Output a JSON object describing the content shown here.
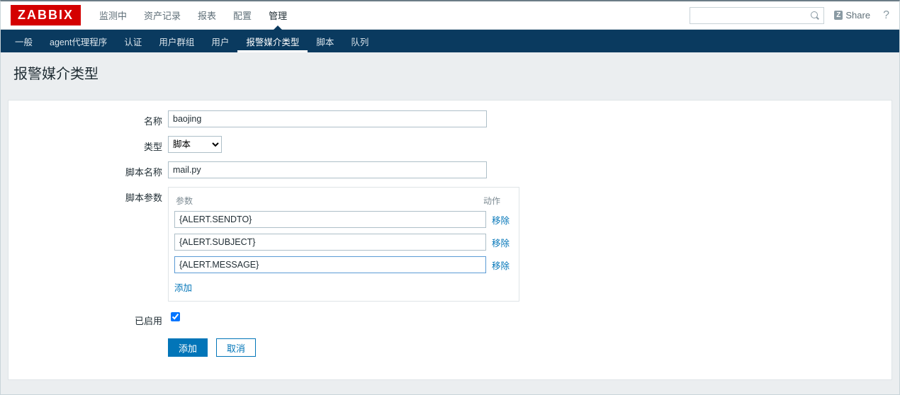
{
  "logo": "ZABBIX",
  "topnav": {
    "items": [
      {
        "label": "监测中"
      },
      {
        "label": "资产记录"
      },
      {
        "label": "报表"
      },
      {
        "label": "配置"
      },
      {
        "label": "管理",
        "active": true
      }
    ],
    "share": "Share",
    "help": "?"
  },
  "subnav": {
    "items": [
      {
        "label": "一般"
      },
      {
        "label": "agent代理程序"
      },
      {
        "label": "认证"
      },
      {
        "label": "用户群组"
      },
      {
        "label": "用户"
      },
      {
        "label": "报警媒介类型",
        "active": true
      },
      {
        "label": "脚本"
      },
      {
        "label": "队列"
      }
    ]
  },
  "page_title": "报警媒介类型",
  "form": {
    "name_label": "名称",
    "name_value": "baojing",
    "type_label": "类型",
    "type_value": "脚本",
    "script_name_label": "脚本名称",
    "script_name_value": "mail.py",
    "params_label": "脚本参数",
    "params_header_param": "参数",
    "params_header_action": "动作",
    "params": [
      {
        "value": "{ALERT.SENDTO}",
        "focused": false
      },
      {
        "value": "{ALERT.SUBJECT}",
        "focused": false
      },
      {
        "value": "{ALERT.MESSAGE}",
        "focused": true
      }
    ],
    "remove_label": "移除",
    "add_param_label": "添加",
    "enabled_label": "已启用",
    "enabled_value": true,
    "submit_label": "添加",
    "cancel_label": "取消"
  }
}
